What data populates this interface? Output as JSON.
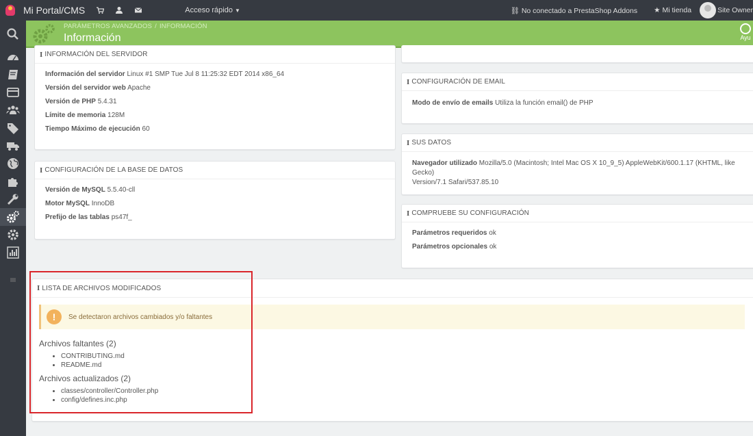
{
  "topbar": {
    "brand": "Mi Portal/CMS",
    "quick_access": "Acceso rápido",
    "addons_status": "No conectado a PrestaShop Addons",
    "my_shop": "Mi tienda",
    "user": "Site Owner"
  },
  "header": {
    "breadcrumb_1": "PARÁMETROS AVANZADOS",
    "breadcrumb_sep": "/",
    "breadcrumb_2": "INFORMACIÓN",
    "title": "Información",
    "help": "Ayu"
  },
  "server": {
    "title": "INFORMACIÓN DEL SERVIDOR",
    "rows": [
      {
        "label": "Información del servidor",
        "value": "Linux #1 SMP Tue Jul 8 11:25:32 EDT 2014 x86_64"
      },
      {
        "label": "Versión del servidor web",
        "value": "Apache"
      },
      {
        "label": "Versión de PHP",
        "value": "5.4.31"
      },
      {
        "label": "Límite de memoria",
        "value": "128M"
      },
      {
        "label": "Tiempo Máximo de ejecución",
        "value": "60"
      }
    ]
  },
  "database": {
    "title": "CONFIGURACIÓN DE LA BASE DE DATOS",
    "rows": [
      {
        "label": "Versión de MySQL",
        "value": "5.5.40-cll"
      },
      {
        "label": "Motor MySQL",
        "value": "InnoDB"
      },
      {
        "label": "Prefijo de las tablas",
        "value": "ps47f_"
      }
    ]
  },
  "email": {
    "title": "CONFIGURACIÓN DE EMAIL",
    "rows": [
      {
        "label": "Modo de envío de emails",
        "value": "Utiliza la función email() de PHP"
      }
    ]
  },
  "your_data": {
    "title": "SUS DATOS",
    "rows": [
      {
        "label": "Navegador utilizado",
        "value": "Mozilla/5.0 (Macintosh; Intel Mac OS X 10_9_5) AppleWebKit/600.1.17 (KHTML, like Gecko)",
        "value2": "Version/7.1 Safari/537.85.10"
      }
    ]
  },
  "check": {
    "title": "COMPRUEBE SU CONFIGURACIÓN",
    "rows": [
      {
        "label": "Parámetros requeridos",
        "value": "ok"
      },
      {
        "label": "Parámetros opcionales",
        "value": "ok"
      }
    ]
  },
  "modified": {
    "title": "LISTA DE ARCHIVOS MODIFICADOS",
    "alert": "Se detectaron archivos cambiados y/o faltantes",
    "alert_icon": "!",
    "missing_title": "Archivos faltantes (2)",
    "missing": [
      "CONTRIBUTING.md",
      "README.md"
    ],
    "updated_title": "Archivos actualizados (2)",
    "updated": [
      "classes/controller/Controller.php",
      "config/defines.inc.php"
    ]
  },
  "icons": {
    "info": "i",
    "sidebar": [
      "search-icon",
      "dashboard-icon",
      "catalog-icon",
      "orders-icon",
      "customers-icon",
      "tags-icon",
      "shipping-icon",
      "localization-icon",
      "modules-icon",
      "preferences-icon",
      "advanced-parameters-icon",
      "settings-icon",
      "stats-icon",
      "menu-collapse-icon"
    ]
  },
  "colors": {
    "header_green": "#8dc45e",
    "topbar": "#363a41",
    "highlight_red": "#d9252a",
    "warning": "#f2b25c"
  }
}
